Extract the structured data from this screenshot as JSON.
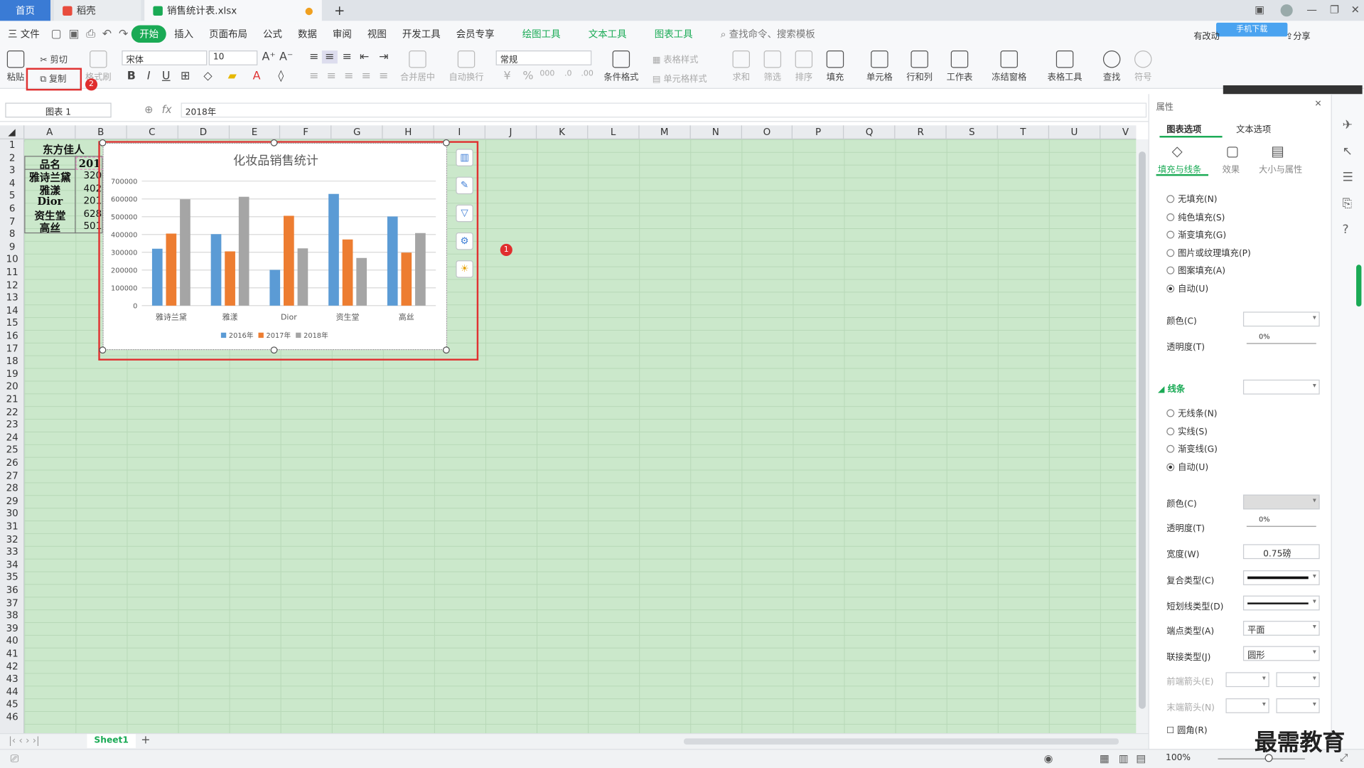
{
  "titlebar": {
    "tab_home": "首页",
    "tab_daoke": "稻壳",
    "tab_file": "销售统计表.xlsx",
    "new_tab": "+"
  },
  "menu": {
    "file": "三 文件",
    "items": [
      "开始",
      "插入",
      "页面布局",
      "公式",
      "数据",
      "审阅",
      "视图",
      "开发工具",
      "会员专享"
    ],
    "context": [
      "绘图工具",
      "文本工具",
      "图表工具"
    ],
    "search": "查找命令、搜索模板",
    "share": "分享",
    "sync": "有改动",
    "cloud_tip": "手机下载"
  },
  "ribbon": {
    "paste": "粘贴",
    "cut": "剪切",
    "copy": "复制",
    "format_painter": "格式刷",
    "font_name": "宋体",
    "font_size": "10",
    "number_format": "常规",
    "merge": "合并居中",
    "wrap": "自动换行",
    "cond_format": "条件格式",
    "table_style": "表格样式",
    "cell_style": "单元格样式",
    "sum": "求和",
    "filter": "筛选",
    "sort": "排序",
    "fill": "填充",
    "cell": "单元格",
    "rowcol": "行和列",
    "sheet": "工作表",
    "freeze": "冻结窗格",
    "table_tools": "表格工具",
    "find": "查找",
    "symbol": "符号"
  },
  "formula": {
    "name_box": "图表 1",
    "fx": "fx",
    "content": "2018年"
  },
  "columns": [
    "A",
    "B",
    "C",
    "D",
    "E",
    "F",
    "G",
    "H",
    "I",
    "J",
    "K",
    "L",
    "M",
    "N",
    "O",
    "P",
    "Q",
    "R",
    "S",
    "T",
    "U",
    "V"
  ],
  "rows": [
    "1",
    "2",
    "3",
    "4",
    "5",
    "6",
    "7",
    "8",
    "9",
    "10",
    "11",
    "12",
    "13",
    "14",
    "15",
    "16",
    "17",
    "18",
    "19",
    "20",
    "21",
    "22",
    "23",
    "24",
    "25",
    "26",
    "27",
    "28",
    "29",
    "30",
    "31",
    "32",
    "33",
    "34",
    "35",
    "36",
    "37",
    "38",
    "39",
    "40",
    "41",
    "42",
    "43",
    "44",
    "45",
    "46"
  ],
  "cells": {
    "title": "东方佳人",
    "header_a": "品名",
    "header_b": "201",
    "a": [
      "雅诗兰黛",
      "雅漾",
      "Dior",
      "资生堂",
      "高丝"
    ],
    "b": [
      "320",
      "402",
      "201",
      "628",
      "501"
    ]
  },
  "chart_data": {
    "type": "bar",
    "title": "化妆品销售统计",
    "categories": [
      "雅诗兰黛",
      "雅漾",
      "Dior",
      "资生堂",
      "高丝"
    ],
    "series": [
      {
        "name": "2016年",
        "values": [
          320000,
          402000,
          201000,
          628000,
          501000
        ],
        "color": "#5b9bd5"
      },
      {
        "name": "2017年",
        "values": [
          405000,
          305000,
          505000,
          372000,
          298000
        ],
        "color": "#ed7d31"
      },
      {
        "name": "2018年",
        "values": [
          598000,
          612000,
          322000,
          268000,
          408000
        ],
        "color": "#a5a5a5"
      }
    ],
    "yticks": [
      "700000",
      "600000",
      "500000",
      "400000",
      "300000",
      "200000",
      "100000",
      "0"
    ],
    "ylim": [
      0,
      700000
    ],
    "grid": true,
    "legend": "bottom"
  },
  "badges": {
    "one": "1",
    "two": "2"
  },
  "panel": {
    "title": "属性",
    "tab_chart": "图表选项",
    "tab_text": "文本选项",
    "sub_fill": "填充与线条",
    "sub_effect": "效果",
    "sub_size": "大小与属性",
    "fill_options": [
      "无填充(N)",
      "纯色填充(S)",
      "渐变填充(G)",
      "图片或纹理填充(P)",
      "图案填充(A)",
      "自动(U)"
    ],
    "color": "颜色(C)",
    "transparency": "透明度(T)",
    "pct": "0%",
    "line_section": "线条",
    "line_options": [
      "无线条(N)",
      "实线(S)",
      "渐变线(G)",
      "自动(U)"
    ],
    "width": "宽度(W)",
    "width_value": "0.75磅",
    "compound": "复合类型(C)",
    "dash": "短划线类型(D)",
    "cap": "端点类型(A)",
    "cap_value": "平面",
    "join": "联接类型(J)",
    "join_value": "圆形",
    "begin_arrow": "前端箭头(E)",
    "end_arrow": "末端箭头(N)",
    "round": "圆角(R)"
  },
  "sheet": {
    "name": "Sheet1",
    "add": "+"
  },
  "status": {
    "zoom": "100%"
  },
  "watermark": "最需教育"
}
